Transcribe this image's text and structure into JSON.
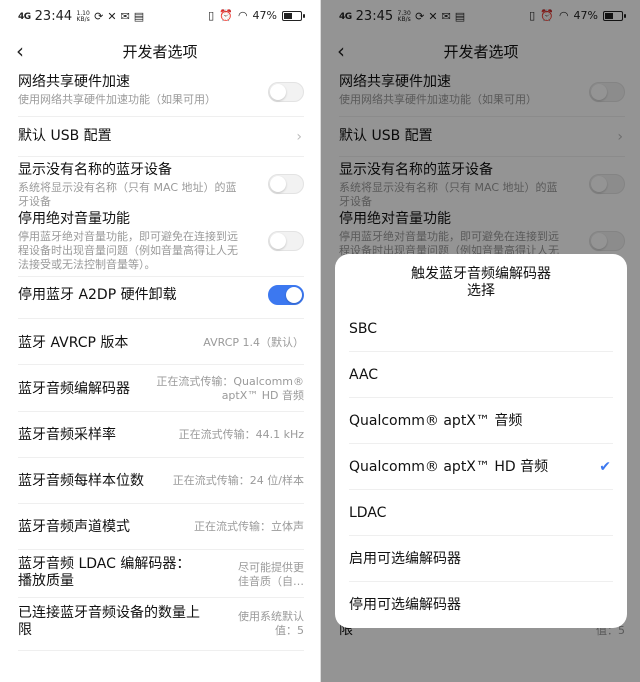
{
  "left_screen": {
    "status": {
      "signal": "4G",
      "time": "23:44",
      "speed_value": "1.10",
      "speed_unit": "KB/s",
      "battery": "47%",
      "battery_level": 0.47
    },
    "title": "开发者选项",
    "items": [
      {
        "title": "网络共享硬件加速",
        "subtitle": "使用网络共享硬件加速功能（如果可用）",
        "toggle": false
      },
      {
        "title": "默认 USB 配置",
        "chevron": true
      },
      {
        "title": "显示没有名称的蓝牙设备",
        "subtitle_l1": "系统将显示没有名称（只有 MAC 地址）的蓝",
        "subtitle_l2": "牙设备",
        "toggle": false
      },
      {
        "title": "停用绝对音量功能",
        "subtitle_l1": "停用蓝牙绝对音量功能，即可避免在连接到远",
        "subtitle_l2": "程设备时出现音量问题（例如音量高得让人无",
        "subtitle_l3": "法接受或无法控制音量等）。",
        "toggle": false
      },
      {
        "title": "停用蓝牙 A2DP 硬件卸载",
        "toggle": true
      },
      {
        "title": "蓝牙 AVRCP 版本",
        "value": "AVRCP 1.4（默认）"
      },
      {
        "title": "蓝牙音频编解码器",
        "value_l1": "正在流式传输：Qualcomm®",
        "value_l2": "aptX™ HD 音频"
      },
      {
        "title": "蓝牙音频采样率",
        "value": "正在流式传输：44.1 kHz"
      },
      {
        "title": "蓝牙音频每样本位数",
        "value": "正在流式传输：24 位/样本"
      },
      {
        "title": "蓝牙音频声道模式",
        "value": "正在流式传输：立体声"
      },
      {
        "title_l1": "蓝牙音频 LDAC 编解码器：",
        "title_l2": "播放质量",
        "value_l1": "尽可能提供更",
        "value_l2": "佳音质（自…"
      },
      {
        "title_l1": "已连接蓝牙音频设备的数量上",
        "title_l2": "限",
        "value_l1": "使用系统默认",
        "value_l2": "值：5"
      }
    ]
  },
  "right_screen": {
    "status": {
      "signal": "4G",
      "time": "23:45",
      "speed_value": "7.30",
      "speed_unit": "KB/s",
      "battery": "47%",
      "battery_level": 0.47
    },
    "dialog": {
      "title_l1": "触发蓝牙音频编解码器",
      "title_l2": "选择",
      "options": [
        "SBC",
        "AAC",
        "Qualcomm® aptX™ 音频",
        "Qualcomm® aptX™ HD 音频",
        "LDAC",
        "启用可选编解码器",
        "停用可选编解码器"
      ],
      "selected_index": 3
    }
  },
  "icons": {
    "back": "back-arrow-icon",
    "chevron": "chevron-right-icon",
    "check": "checkmark-icon",
    "vibrate": "vibrate-icon",
    "alarm": "alarm-icon",
    "wifi": "wifi-icon",
    "battery": "battery-icon"
  },
  "colors": {
    "accent": "#3c78f0",
    "dim_overlay": "rgba(0,0,0,0.42)"
  }
}
